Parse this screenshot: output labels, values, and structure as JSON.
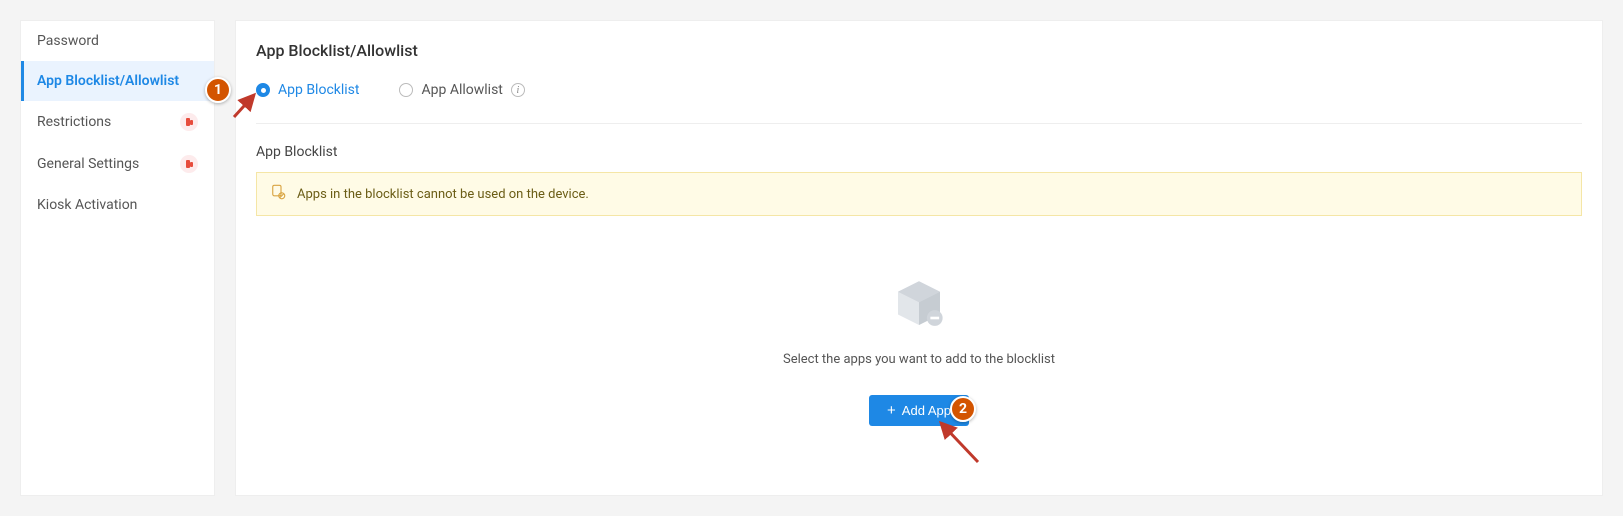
{
  "sidebar": {
    "items": [
      {
        "label": "Password",
        "active": false,
        "badge": false
      },
      {
        "label": "App Blocklist/Allowlist",
        "active": true,
        "badge": false
      },
      {
        "label": "Restrictions",
        "active": false,
        "badge": true
      },
      {
        "label": "General Settings",
        "active": false,
        "badge": true
      },
      {
        "label": "Kiosk Activation",
        "active": false,
        "badge": false
      }
    ]
  },
  "page": {
    "title": "App Blocklist/Allowlist"
  },
  "radios": {
    "blocklist_label": "App Blocklist",
    "allowlist_label": "App Allowlist"
  },
  "section": {
    "title": "App Blocklist"
  },
  "notice": {
    "text": "Apps in the blocklist cannot be used on the device."
  },
  "empty": {
    "text": "Select the apps you want to add to the blocklist",
    "button_label": "Add App"
  },
  "annotations": {
    "one": "1",
    "two": "2"
  }
}
